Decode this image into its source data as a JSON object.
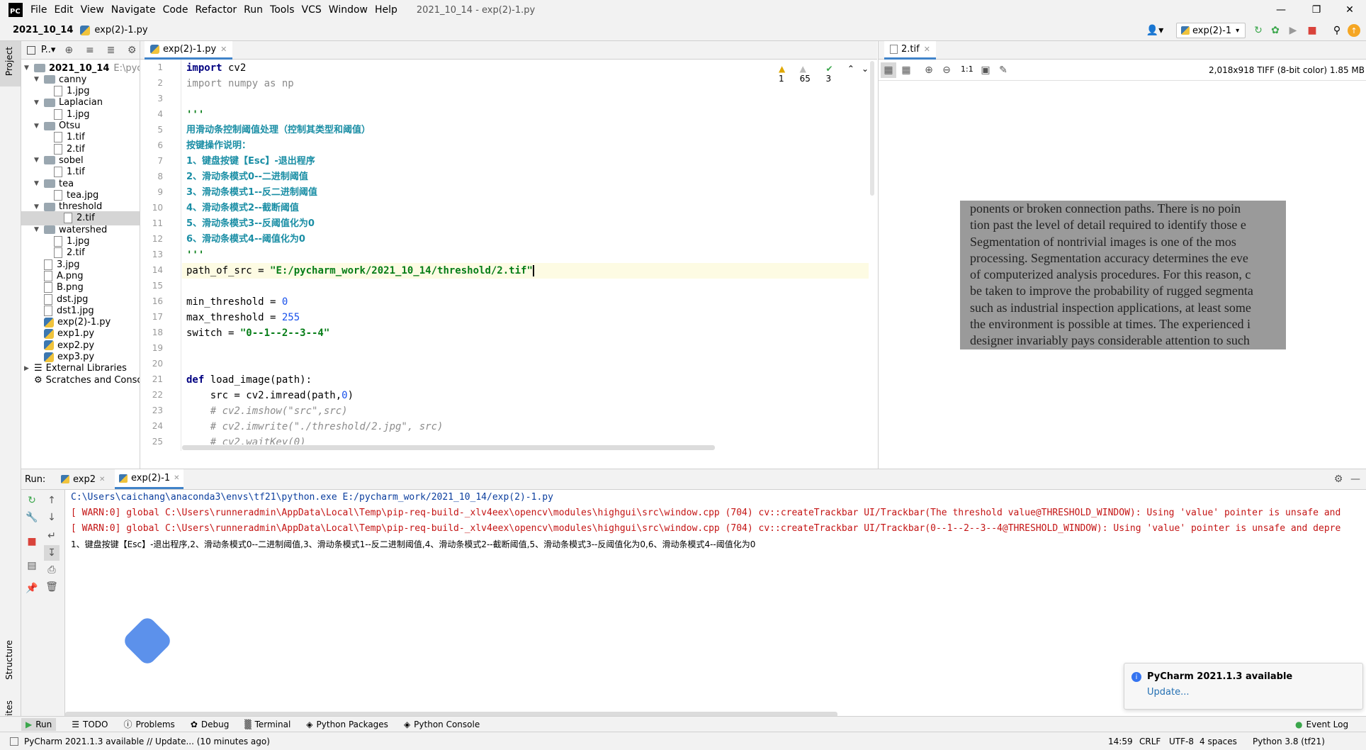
{
  "menubar": {
    "items": [
      "File",
      "Edit",
      "View",
      "Navigate",
      "Code",
      "Refactor",
      "Run",
      "Tools",
      "VCS",
      "Window",
      "Help"
    ],
    "title": "2021_10_14 - exp(2)-1.py"
  },
  "navbar": {
    "breadcrumb_project": "2021_10_14",
    "breadcrumb_file": "exp(2)-1.py",
    "run_config": "exp(2)-1"
  },
  "leftstripe": {
    "project": "Project",
    "structure": "Structure",
    "favorites": "Favorites"
  },
  "project": {
    "header": "P..▾",
    "root_label": "2021_10_14",
    "root_path": "E:\\pychar",
    "tree": [
      {
        "label": "canny",
        "kind": "folder",
        "level": 1,
        "open": true
      },
      {
        "label": "1.jpg",
        "kind": "file",
        "level": 2
      },
      {
        "label": "Laplacian",
        "kind": "folder",
        "level": 1,
        "open": true
      },
      {
        "label": "1.jpg",
        "kind": "file",
        "level": 2
      },
      {
        "label": "Otsu",
        "kind": "folder",
        "level": 1,
        "open": true
      },
      {
        "label": "1.tif",
        "kind": "file",
        "level": 2
      },
      {
        "label": "2.tif",
        "kind": "file",
        "level": 2
      },
      {
        "label": "sobel",
        "kind": "folder",
        "level": 1,
        "open": true
      },
      {
        "label": "1.tif",
        "kind": "file",
        "level": 2
      },
      {
        "label": "tea",
        "kind": "folder",
        "level": 1,
        "open": true
      },
      {
        "label": "tea.jpg",
        "kind": "file",
        "level": 2
      },
      {
        "label": "threshold",
        "kind": "folder",
        "level": 1,
        "open": true
      },
      {
        "label": "2.tif",
        "kind": "file",
        "level": 2,
        "selected": true
      },
      {
        "label": "watershed",
        "kind": "folder",
        "level": 1,
        "open": true
      },
      {
        "label": "1.jpg",
        "kind": "file",
        "level": 2
      },
      {
        "label": "2.tif",
        "kind": "file",
        "level": 2
      },
      {
        "label": "3.jpg",
        "kind": "file",
        "level": 1
      },
      {
        "label": "A.png",
        "kind": "file",
        "level": 1
      },
      {
        "label": "B.png",
        "kind": "file",
        "level": 1
      },
      {
        "label": "dst.jpg",
        "kind": "file",
        "level": 1
      },
      {
        "label": "dst1.jpg",
        "kind": "file",
        "level": 1
      },
      {
        "label": "exp(2)-1.py",
        "kind": "py",
        "level": 1
      },
      {
        "label": "exp1.py",
        "kind": "py",
        "level": 1
      },
      {
        "label": "exp2.py",
        "kind": "py",
        "level": 1
      },
      {
        "label": "exp3.py",
        "kind": "py",
        "level": 1
      }
    ],
    "external_libraries": "External Libraries",
    "scratches": "Scratches and Consoles"
  },
  "editor": {
    "tab": "exp(2)-1.py",
    "inspections": {
      "warnings": "1",
      "weak_warnings": "65",
      "typos": "3"
    },
    "line_numbers": [
      "1",
      "2",
      "3",
      "4",
      "5",
      "6",
      "7",
      "8",
      "9",
      "10",
      "11",
      "12",
      "13",
      "14",
      "15",
      "16",
      "17",
      "18",
      "19",
      "20",
      "21",
      "22",
      "23",
      "24",
      "25"
    ],
    "lines": {
      "l1_kw": "import",
      "l1_rest": " cv2",
      "l2_kw": "import",
      "l2_a": " numpy ",
      "l2_as": "as",
      "l2_b": " np",
      "l4": "'''",
      "l5": "用滑动条控制阈值处理（控制其类型和阈值）",
      "l6": "按键操作说明：",
      "l7": "1、键盘按键【Esc】-退出程序",
      "l8": "2、滑动条模式0--二进制阈值",
      "l9": "3、滑动条模式1--反二进制阈值",
      "l10": "4、滑动条模式2--截断阈值",
      "l11": "5、滑动条模式3--反阈值化为0",
      "l12": "6、滑动条模式4--阈值化为0",
      "l13": "'''",
      "l14_a": "path_of_src = ",
      "l14_str": "\"E:/pycharm_work/2021_10_14/threshold/2.tif\"",
      "l16_a": "min_threshold = ",
      "l16_num": "0",
      "l17_a": "max_threshold = ",
      "l17_num": "255",
      "l18_a": "switch = ",
      "l18_str": "\"0--1--2--3--4\"",
      "l21_kw": "def",
      "l21_rest": " load_image(path):",
      "l22_a": "    src = cv2.imread(path,",
      "l22_num": "0",
      "l22_b": ")",
      "l23": "    # cv2.imshow(\"src\",src)",
      "l24": "    # cv2.imwrite(\"./threshold/2.jpg\", src)",
      "l25": "    # cv2.waitKey(0)"
    }
  },
  "viewer": {
    "tab": "2.tif",
    "zoom_label": "1:1",
    "info": "2,018x918 TIFF (8-bit color) 1.85 MB",
    "image_text": [
      "ponents or broken connection paths. There is no poin",
      "tion past the level of detail required to identify those e",
      "   Segmentation of nontrivial images is one of the mos",
      "processing. Segmentation accuracy determines the eve",
      "of computerized analysis procedures. For this reason, c",
      "be taken to improve the probability of rugged segmenta",
      "such as industrial inspection applications, at least some",
      "the environment is possible at times. The experienced i",
      "designer invariably pays considerable attention to such"
    ]
  },
  "run": {
    "label": "Run:",
    "tabs": [
      "exp2",
      "exp(2)-1"
    ],
    "console": {
      "cmd": "C:\\Users\\caichang\\anaconda3\\envs\\tf21\\python.exe E:/pycharm_work/2021_10_14/exp(2)-1.py",
      "warn1": "[ WARN:0] global C:\\Users\\runneradmin\\AppData\\Local\\Temp\\pip-req-build-_xlv4eex\\opencv\\modules\\highgui\\src\\window.cpp (704) cv::createTrackbar UI/Trackbar(The threshold value@THRESHOLD_WINDOW): Using 'value' pointer is unsafe and",
      "warn2": "[ WARN:0] global C:\\Users\\runneradmin\\AppData\\Local\\Temp\\pip-req-build-_xlv4eex\\opencv\\modules\\highgui\\src\\window.cpp (704) cv::createTrackbar UI/Trackbar(0--1--2--3--4@THRESHOLD_WINDOW): Using 'value' pointer is unsafe and depre",
      "out": "1、键盘按键【Esc】-退出程序,2、滑动条模式0--二进制阈值,3、滑动条模式1--反二进制阈值,4、滑动条模式2--截断阈值,5、滑动条模式3--反阈值化为0,6、滑动条模式4--阈值化为0"
    }
  },
  "notification": {
    "title": "PyCharm 2021.1.3 available",
    "link": "Update..."
  },
  "bottombar": {
    "tools": [
      "Run",
      "TODO",
      "Problems",
      "Debug",
      "Terminal",
      "Python Packages",
      "Python Console"
    ],
    "event_log": "Event Log"
  },
  "statusbar": {
    "message": "PyCharm 2021.1.3 available // Update... (10 minutes ago)",
    "position": "14:59",
    "line_sep": "CRLF",
    "encoding": "UTF-8",
    "indent": "4 spaces",
    "interpreter": "Python 3.8 (tf21)"
  }
}
